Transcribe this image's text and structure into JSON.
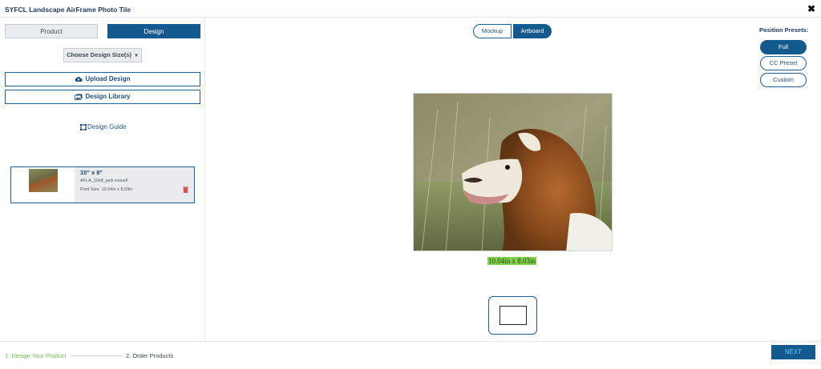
{
  "window": {
    "title": "SYFCL Landscape AirFrame Photo Tile",
    "close": "✖"
  },
  "left_panel": {
    "tabs": [
      {
        "label": "Product"
      },
      {
        "label": "Design"
      }
    ],
    "choose_size": "Choose Design Size(s)",
    "upload": "Upload Design",
    "library": "Design Library",
    "guide": "Design Guide",
    "design_card": {
      "size": "10\" x 8\"",
      "filename": "AFLA_10x8_jack-russell",
      "print_size": "Print Size: 10.04in x 8.03in"
    }
  },
  "canvas": {
    "view_toggle": [
      {
        "label": "Mockup"
      },
      {
        "label": "Artboard"
      }
    ],
    "active_view": "Artboard",
    "dimensions_label": "10.04in x 8.03in"
  },
  "presets": {
    "title": "Position Presets:",
    "options": [
      {
        "label": "Full"
      },
      {
        "label": "CC Preset"
      },
      {
        "label": "Custom"
      }
    ],
    "selected": "Full"
  },
  "footer": {
    "steps": [
      {
        "label": "1. Design Your Product"
      },
      {
        "label": "2. Order Products"
      }
    ],
    "active_step": "1. Design Your Product",
    "next": "NEXT"
  },
  "colors": {
    "primary": "#155a8e",
    "active_step": "#6cc24a",
    "dim_highlight": "#7fd14b",
    "next_text": "#5fd0ff"
  }
}
